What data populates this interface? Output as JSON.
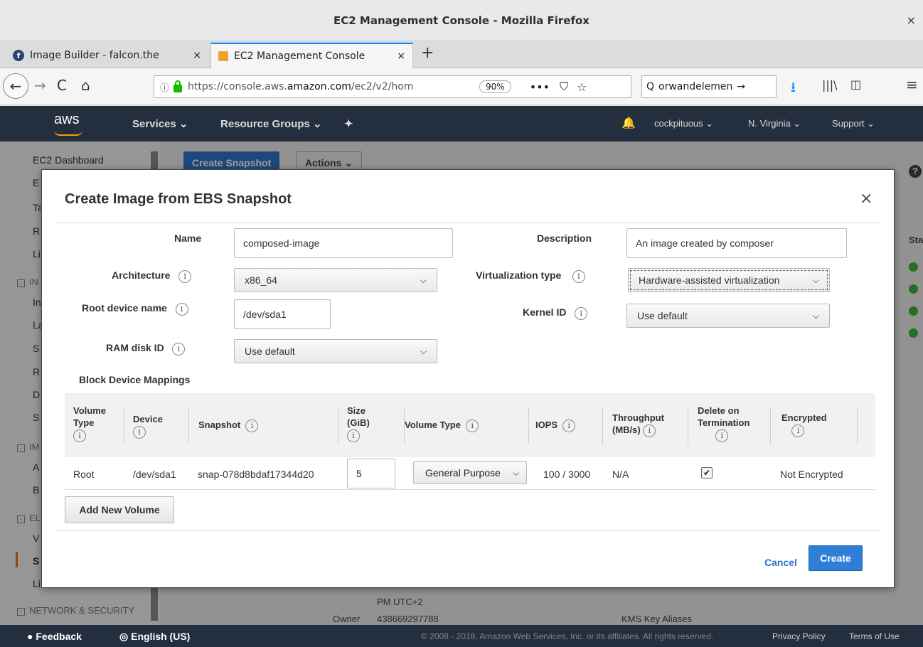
{
  "window": {
    "title": "EC2 Management Console - Mozilla Firefox",
    "close": "×"
  },
  "tabs": [
    {
      "label": "Image Builder - falcon.the",
      "close": "×"
    },
    {
      "label": "EC2 Management Console",
      "close": "×"
    }
  ],
  "newtab": "+",
  "nav": {
    "back": "←",
    "forward": "→",
    "reload": "C",
    "home": "⌂",
    "info": "ⓘ",
    "url_prefix": "https://console.aws.",
    "url_domain": "amazon.com",
    "url_suffix": "/ec2/v2/hom",
    "zoom": "90%",
    "more": "•••",
    "pocket": "⛉",
    "star": "☆",
    "search_icon": "Q",
    "search_value": "orwandelemen",
    "search_go": "→",
    "download": "⭳",
    "library": "|||\\",
    "sidebar": "◫",
    "menu": "≡"
  },
  "aws": {
    "logo": "aws",
    "services": "Services ⌄",
    "resource_groups": "Resource Groups ⌄",
    "pin": "✦",
    "bell": "🔔",
    "account": "cockpituous ⌄",
    "region": "N. Virginia ⌄",
    "support": "Support ⌄"
  },
  "sidebar": {
    "dashboard": "EC2 Dashboard",
    "partial_items": [
      "E",
      "Ta",
      "R",
      "Li",
      "In",
      "La",
      "S",
      "R",
      "D",
      "S",
      "A",
      "B",
      "V",
      "S",
      "Li"
    ],
    "sections": [
      "IN",
      "IM",
      "EL"
    ],
    "network": "NETWORK & SECURITY"
  },
  "background": {
    "create_snapshot": "Create Snapshot",
    "actions": "Actions ⌄",
    "sta": "Sta",
    "pm": "PM UTC+2",
    "owner_label": "Owner",
    "owner_value": "438669297788",
    "kms": "KMS Key Aliases",
    "help": "?"
  },
  "footer": {
    "feedback": "Feedback",
    "language": "English (US)",
    "copyright": "© 2008 - 2018, Amazon Web Services, Inc. or its affiliates. All rights reserved.",
    "privacy": "Privacy Policy",
    "terms": "Terms of Use"
  },
  "modal": {
    "title": "Create Image from EBS Snapshot",
    "close": "×",
    "info": "i",
    "chevron": "❯",
    "fields": {
      "name_label": "Name",
      "name_value": "composed-image",
      "description_label": "Description",
      "description_value": "An image created by composer",
      "architecture_label": "Architecture",
      "architecture_value": "x86_64",
      "virtualization_label": "Virtualization type",
      "virtualization_value": "Hardware-assisted virtualization",
      "root_device_label": "Root device name",
      "root_device_value": "/dev/sda1",
      "kernel_label": "Kernel ID",
      "kernel_value": "Use default",
      "ramdisk_label": "RAM disk ID",
      "ramdisk_value": "Use default"
    },
    "bdm": {
      "title": "Block Device Mappings",
      "headers": {
        "volume_type": [
          "Volume",
          "Type"
        ],
        "device": "Device",
        "snapshot": "Snapshot",
        "size": [
          "Size",
          "(GiB)"
        ],
        "vol_type": "Volume Type",
        "iops": "IOPS",
        "throughput": [
          "Throughput",
          "(MB/s)"
        ],
        "delete": [
          "Delete on",
          "Termination"
        ],
        "encrypted": "Encrypted"
      },
      "row": {
        "volume_type": "Root",
        "device": "/dev/sda1",
        "snapshot": "snap-078d8bdaf17344d20",
        "size": "5",
        "vol_type": "General Purpose",
        "iops": "100 / 3000",
        "throughput": "N/A",
        "delete_checked": "✔",
        "encrypted": "Not Encrypted"
      },
      "add_button": "Add New Volume"
    },
    "cancel": "Cancel",
    "create": "Create"
  }
}
